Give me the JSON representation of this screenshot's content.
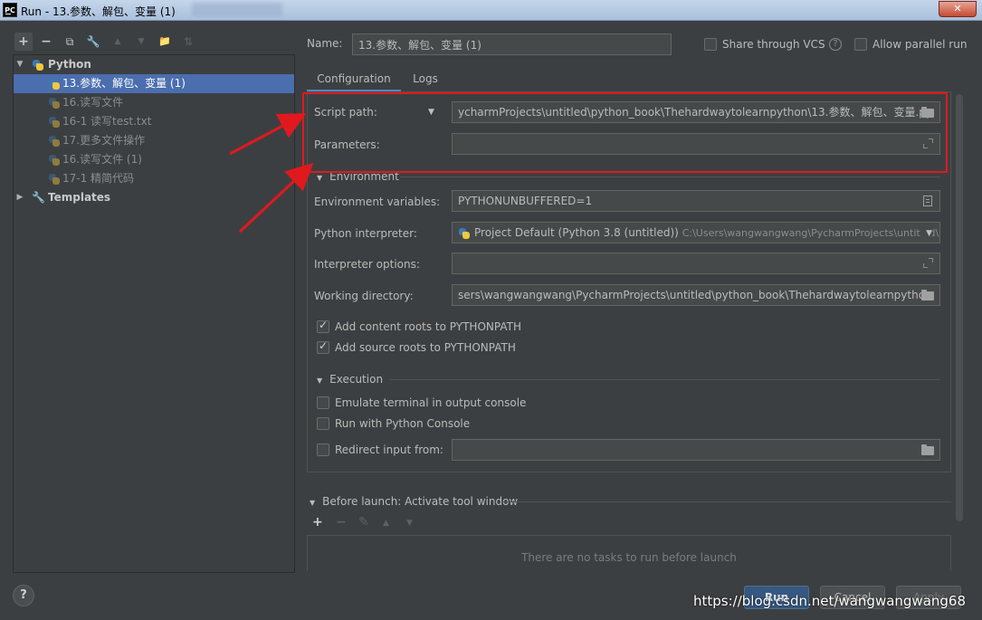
{
  "window": {
    "app_icon_text": "PC",
    "title": "Run - 13.参数、解包、变量 (1)",
    "close_label": "✕"
  },
  "left_toolbar": {
    "add": "+",
    "remove": "−",
    "copy": "⧉",
    "settings": "🔧",
    "up": "▲",
    "down": "▼",
    "folder": "📁",
    "sort": "⇅"
  },
  "tree": {
    "python_group": "Python",
    "items": [
      "13.参数、解包、变量 (1)",
      "16.读写文件",
      "16-1 读写test.txt",
      "17.更多文件操作",
      "16.读写文件 (1)",
      "17-1 精简代码"
    ],
    "templates": "Templates"
  },
  "header": {
    "name_label": "Name:",
    "name_value": "13.参数、解包、变量 (1)",
    "share_vcs": "Share through VCS",
    "share_vcs_checked": false,
    "allow_parallel": "Allow parallel run",
    "allow_parallel_checked": false
  },
  "tabs": [
    "Configuration",
    "Logs"
  ],
  "config": {
    "script_path_label": "Script path:",
    "script_path_value": "ycharmProjects\\untitled\\python_book\\Thehardwaytolearnpython\\13.参数、解包、变量.py",
    "parameters_label": "Parameters:",
    "parameters_value": "",
    "environment_section": "Environment",
    "env_vars_label": "Environment variables:",
    "env_vars_value": "PYTHONUNBUFFERED=1",
    "interpreter_label": "Python interpreter:",
    "interpreter_value": "Project Default (Python 3.8 (untitled))",
    "interpreter_path": "C:\\Users\\wangwangwang\\PycharmProjects\\untitled\\",
    "interp_options_label": "Interpreter options:",
    "interp_options_value": "",
    "working_dir_label": "Working directory:",
    "working_dir_value": "sers\\wangwangwang\\PycharmProjects\\untitled\\python_book\\Thehardwaytolearnpython",
    "add_content_roots": "Add content roots to PYTHONPATH",
    "add_content_roots_checked": true,
    "add_source_roots": "Add source roots to PYTHONPATH",
    "add_source_roots_checked": true,
    "execution_section": "Execution",
    "emulate_terminal": "Emulate terminal in output console",
    "emulate_terminal_checked": false,
    "run_with_console": "Run with Python Console",
    "run_with_console_checked": false,
    "redirect_input": "Redirect input from:",
    "redirect_input_checked": false,
    "redirect_input_value": ""
  },
  "before_launch": {
    "title": "Before launch: Activate tool window",
    "add": "+",
    "remove": "−",
    "edit": "✎",
    "up": "▲",
    "down": "▼",
    "empty_text": "There are no tasks to run before launch"
  },
  "footer": {
    "help": "?",
    "run": "Run",
    "cancel": "Cancel",
    "apply": "Apply",
    "watermark": "https://blog.csdn.net/wangwangwang68"
  },
  "colors": {
    "background": "#3c3f41",
    "selection": "#4b6eaf",
    "annotation_red": "#e0191e",
    "primary_button": "#365880"
  }
}
